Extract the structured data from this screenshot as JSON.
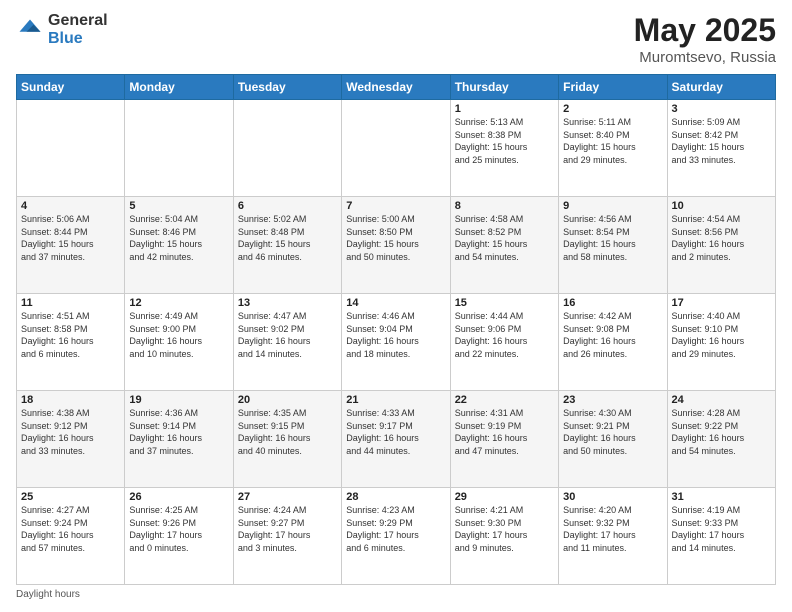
{
  "logo": {
    "general": "General",
    "blue": "Blue"
  },
  "title": {
    "month": "May 2025",
    "location": "Muromtsevo, Russia"
  },
  "weekdays": [
    "Sunday",
    "Monday",
    "Tuesday",
    "Wednesday",
    "Thursday",
    "Friday",
    "Saturday"
  ],
  "footer": {
    "daylight_label": "Daylight hours"
  },
  "weeks": [
    [
      {
        "day": "",
        "info": ""
      },
      {
        "day": "",
        "info": ""
      },
      {
        "day": "",
        "info": ""
      },
      {
        "day": "",
        "info": ""
      },
      {
        "day": "1",
        "info": "Sunrise: 5:13 AM\nSunset: 8:38 PM\nDaylight: 15 hours\nand 25 minutes."
      },
      {
        "day": "2",
        "info": "Sunrise: 5:11 AM\nSunset: 8:40 PM\nDaylight: 15 hours\nand 29 minutes."
      },
      {
        "day": "3",
        "info": "Sunrise: 5:09 AM\nSunset: 8:42 PM\nDaylight: 15 hours\nand 33 minutes."
      }
    ],
    [
      {
        "day": "4",
        "info": "Sunrise: 5:06 AM\nSunset: 8:44 PM\nDaylight: 15 hours\nand 37 minutes."
      },
      {
        "day": "5",
        "info": "Sunrise: 5:04 AM\nSunset: 8:46 PM\nDaylight: 15 hours\nand 42 minutes."
      },
      {
        "day": "6",
        "info": "Sunrise: 5:02 AM\nSunset: 8:48 PM\nDaylight: 15 hours\nand 46 minutes."
      },
      {
        "day": "7",
        "info": "Sunrise: 5:00 AM\nSunset: 8:50 PM\nDaylight: 15 hours\nand 50 minutes."
      },
      {
        "day": "8",
        "info": "Sunrise: 4:58 AM\nSunset: 8:52 PM\nDaylight: 15 hours\nand 54 minutes."
      },
      {
        "day": "9",
        "info": "Sunrise: 4:56 AM\nSunset: 8:54 PM\nDaylight: 15 hours\nand 58 minutes."
      },
      {
        "day": "10",
        "info": "Sunrise: 4:54 AM\nSunset: 8:56 PM\nDaylight: 16 hours\nand 2 minutes."
      }
    ],
    [
      {
        "day": "11",
        "info": "Sunrise: 4:51 AM\nSunset: 8:58 PM\nDaylight: 16 hours\nand 6 minutes."
      },
      {
        "day": "12",
        "info": "Sunrise: 4:49 AM\nSunset: 9:00 PM\nDaylight: 16 hours\nand 10 minutes."
      },
      {
        "day": "13",
        "info": "Sunrise: 4:47 AM\nSunset: 9:02 PM\nDaylight: 16 hours\nand 14 minutes."
      },
      {
        "day": "14",
        "info": "Sunrise: 4:46 AM\nSunset: 9:04 PM\nDaylight: 16 hours\nand 18 minutes."
      },
      {
        "day": "15",
        "info": "Sunrise: 4:44 AM\nSunset: 9:06 PM\nDaylight: 16 hours\nand 22 minutes."
      },
      {
        "day": "16",
        "info": "Sunrise: 4:42 AM\nSunset: 9:08 PM\nDaylight: 16 hours\nand 26 minutes."
      },
      {
        "day": "17",
        "info": "Sunrise: 4:40 AM\nSunset: 9:10 PM\nDaylight: 16 hours\nand 29 minutes."
      }
    ],
    [
      {
        "day": "18",
        "info": "Sunrise: 4:38 AM\nSunset: 9:12 PM\nDaylight: 16 hours\nand 33 minutes."
      },
      {
        "day": "19",
        "info": "Sunrise: 4:36 AM\nSunset: 9:14 PM\nDaylight: 16 hours\nand 37 minutes."
      },
      {
        "day": "20",
        "info": "Sunrise: 4:35 AM\nSunset: 9:15 PM\nDaylight: 16 hours\nand 40 minutes."
      },
      {
        "day": "21",
        "info": "Sunrise: 4:33 AM\nSunset: 9:17 PM\nDaylight: 16 hours\nand 44 minutes."
      },
      {
        "day": "22",
        "info": "Sunrise: 4:31 AM\nSunset: 9:19 PM\nDaylight: 16 hours\nand 47 minutes."
      },
      {
        "day": "23",
        "info": "Sunrise: 4:30 AM\nSunset: 9:21 PM\nDaylight: 16 hours\nand 50 minutes."
      },
      {
        "day": "24",
        "info": "Sunrise: 4:28 AM\nSunset: 9:22 PM\nDaylight: 16 hours\nand 54 minutes."
      }
    ],
    [
      {
        "day": "25",
        "info": "Sunrise: 4:27 AM\nSunset: 9:24 PM\nDaylight: 16 hours\nand 57 minutes."
      },
      {
        "day": "26",
        "info": "Sunrise: 4:25 AM\nSunset: 9:26 PM\nDaylight: 17 hours\nand 0 minutes."
      },
      {
        "day": "27",
        "info": "Sunrise: 4:24 AM\nSunset: 9:27 PM\nDaylight: 17 hours\nand 3 minutes."
      },
      {
        "day": "28",
        "info": "Sunrise: 4:23 AM\nSunset: 9:29 PM\nDaylight: 17 hours\nand 6 minutes."
      },
      {
        "day": "29",
        "info": "Sunrise: 4:21 AM\nSunset: 9:30 PM\nDaylight: 17 hours\nand 9 minutes."
      },
      {
        "day": "30",
        "info": "Sunrise: 4:20 AM\nSunset: 9:32 PM\nDaylight: 17 hours\nand 11 minutes."
      },
      {
        "day": "31",
        "info": "Sunrise: 4:19 AM\nSunset: 9:33 PM\nDaylight: 17 hours\nand 14 minutes."
      }
    ]
  ]
}
